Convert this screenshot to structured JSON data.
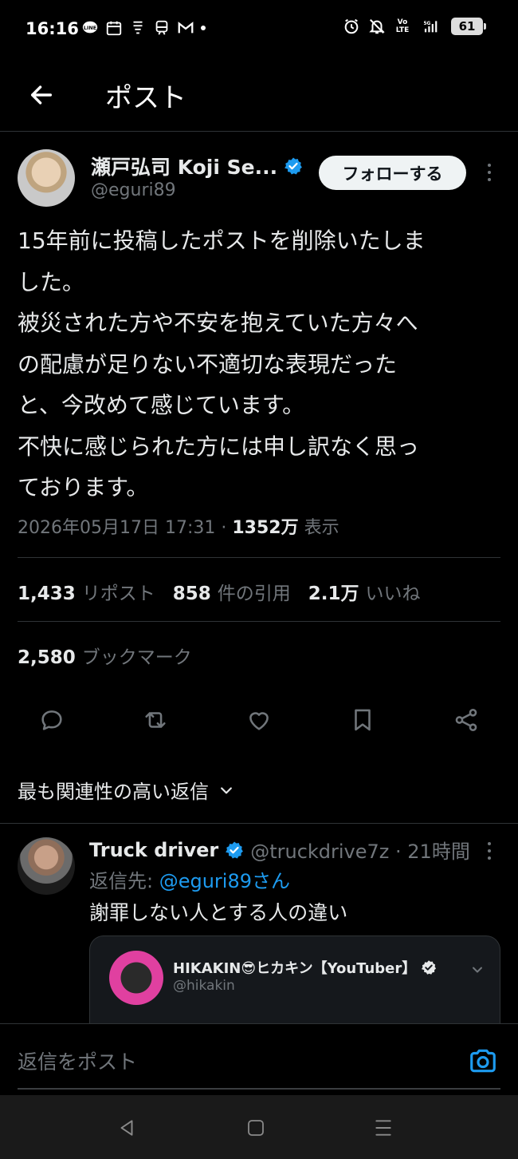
{
  "status_bar": {
    "time": "16:16",
    "battery": "61",
    "left_icons": [
      "line-icon",
      "calendar-icon",
      "app-icon",
      "train-icon",
      "gmail-icon"
    ],
    "right_icons": [
      "alarm-icon",
      "mute-icon",
      "volte-icon",
      "signal-5g-icon"
    ],
    "volte_label": "Vo LTE",
    "net_label": "5G"
  },
  "header": {
    "title": "ポスト"
  },
  "tweet": {
    "author_name": "瀬戸弘司 Koji Se...",
    "author_handle": "@eguri89",
    "follow_label": "フォローする",
    "lines": [
      "15年前に投稿したポストを削除いたしま",
      "した。",
      "被災された方や不安を抱えていた方々へ",
      "の配慮が足りない不適切な表現だった",
      "と、今改めて感じています。",
      "不快に感じられた方には申し訳なく思っ",
      "ております。"
    ],
    "timestamp": "2026年05月17日 17:31",
    "separator": " · ",
    "views_count": "1352万",
    "views_label": "表示",
    "stats": [
      {
        "num": "1,433",
        "label": "リポスト"
      },
      {
        "num": "858",
        "label": "件の引用"
      },
      {
        "num": "2.1万",
        "label": "いいね"
      }
    ],
    "bookmarks": {
      "num": "2,580",
      "label": "ブックマーク"
    }
  },
  "relevance_label": "最も関連性の高い返信",
  "reply": {
    "name": "Truck driver",
    "handle": "@truckdrive7z · 21時間",
    "reply_to_prefix": "返信先: ",
    "reply_to_handle": "@eguri89さん",
    "text": "謝罪しない人とする人の違い",
    "quote": {
      "name": "HIKAKIN😎ヒカキン【YouTuber】",
      "handle": "@hikakin"
    }
  },
  "compose": {
    "placeholder": "返信をポスト"
  },
  "colors": {
    "accent": "#1d9bf0",
    "muted": "#71767b",
    "text": "#e7e9ea",
    "divider": "#2f3336"
  }
}
